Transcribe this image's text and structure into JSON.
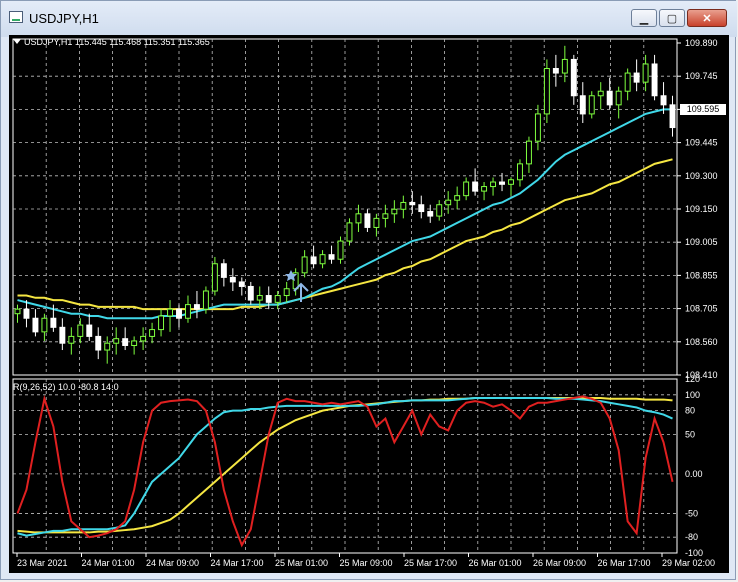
{
  "window": {
    "title": "USDJPY,H1"
  },
  "buttons": {
    "minimize": "▁",
    "maximize": "▢",
    "close": "✕"
  },
  "main_pane": {
    "info": "USDJPY,H1  115.445 115.468 115.351 115.365",
    "price_labels": [
      "109.890",
      "109.745",
      "109.595",
      "109.445",
      "109.300",
      "109.150",
      "109.005",
      "108.855",
      "108.705",
      "108.560",
      "108.410"
    ],
    "current_price": "109.595"
  },
  "indicator_pane": {
    "info": "R(9,26,52) 10.0 -80.8 14.0",
    "level_labels": [
      "120",
      "100",
      "80",
      "50",
      "0.00",
      "-50",
      "-80",
      "-100"
    ]
  },
  "time_labels": [
    "23 Mar 2021",
    "24 Mar 01:00",
    "24 Mar 09:00",
    "24 Mar 17:00",
    "25 Mar 01:00",
    "25 Mar 09:00",
    "25 Mar 17:00",
    "26 Mar 01:00",
    "26 Mar 09:00",
    "26 Mar 17:00",
    "29 Mar 02:00"
  ],
  "colors": {
    "background": "#000000",
    "up_candle": "#7fff3f",
    "down_candle": "#ffffff",
    "ma_fast": "#40d8e8",
    "ma_slow": "#f5e642",
    "osc_red": "#e02020",
    "grid": "#c0c0c0"
  },
  "chart_data": [
    {
      "type": "candlestick",
      "title": "USDJPY,H1",
      "ylim": [
        108.41,
        109.89
      ],
      "candles": [
        [
          108.68,
          108.72,
          108.64,
          108.7
        ],
        [
          108.7,
          108.74,
          108.62,
          108.66
        ],
        [
          108.66,
          108.7,
          108.58,
          108.6
        ],
        [
          108.6,
          108.68,
          108.56,
          108.66
        ],
        [
          108.66,
          108.72,
          108.6,
          108.62
        ],
        [
          108.62,
          108.66,
          108.52,
          108.55
        ],
        [
          108.55,
          108.62,
          108.5,
          108.58
        ],
        [
          108.58,
          108.66,
          108.55,
          108.63
        ],
        [
          108.63,
          108.68,
          108.56,
          108.58
        ],
        [
          108.58,
          108.62,
          108.48,
          108.52
        ],
        [
          108.52,
          108.58,
          108.46,
          108.55
        ],
        [
          108.55,
          108.62,
          108.5,
          108.57
        ],
        [
          108.57,
          108.62,
          108.52,
          108.54
        ],
        [
          108.54,
          108.58,
          108.5,
          108.56
        ],
        [
          108.56,
          108.62,
          108.52,
          108.58
        ],
        [
          108.58,
          108.64,
          108.55,
          108.61
        ],
        [
          108.61,
          108.7,
          108.58,
          108.67
        ],
        [
          108.67,
          108.74,
          108.6,
          108.7
        ],
        [
          108.7,
          108.72,
          108.62,
          108.66
        ],
        [
          108.66,
          108.76,
          108.64,
          108.72
        ],
        [
          108.72,
          108.78,
          108.66,
          108.7
        ],
        [
          108.7,
          108.8,
          108.68,
          108.78
        ],
        [
          108.78,
          108.93,
          108.76,
          108.9
        ],
        [
          108.9,
          108.92,
          108.8,
          108.84
        ],
        [
          108.84,
          108.88,
          108.78,
          108.82
        ],
        [
          108.82,
          108.84,
          108.76,
          108.8
        ],
        [
          108.8,
          108.82,
          108.72,
          108.74
        ],
        [
          108.74,
          108.8,
          108.7,
          108.76
        ],
        [
          108.76,
          108.8,
          108.7,
          108.73
        ],
        [
          108.73,
          108.78,
          108.7,
          108.76
        ],
        [
          108.76,
          108.82,
          108.73,
          108.79
        ],
        [
          108.79,
          108.88,
          108.76,
          108.86
        ],
        [
          108.86,
          108.96,
          108.84,
          108.93
        ],
        [
          108.93,
          108.98,
          108.88,
          108.9
        ],
        [
          108.9,
          108.96,
          108.88,
          108.94
        ],
        [
          108.94,
          108.98,
          108.9,
          108.92
        ],
        [
          108.92,
          109.02,
          108.9,
          109.0
        ],
        [
          109.0,
          109.1,
          108.98,
          109.08
        ],
        [
          109.08,
          109.16,
          109.04,
          109.12
        ],
        [
          109.12,
          109.14,
          109.04,
          109.06
        ],
        [
          109.06,
          109.12,
          109.02,
          109.1
        ],
        [
          109.1,
          109.16,
          109.06,
          109.12
        ],
        [
          109.12,
          109.18,
          109.08,
          109.14
        ],
        [
          109.14,
          109.2,
          109.1,
          109.17
        ],
        [
          109.17,
          109.22,
          109.12,
          109.16
        ],
        [
          109.16,
          109.2,
          109.1,
          109.13
        ],
        [
          109.13,
          109.16,
          109.08,
          109.11
        ],
        [
          109.11,
          109.18,
          109.09,
          109.16
        ],
        [
          109.16,
          109.22,
          109.12,
          109.18
        ],
        [
          109.18,
          109.24,
          109.14,
          109.2
        ],
        [
          109.2,
          109.28,
          109.18,
          109.26
        ],
        [
          109.26,
          109.32,
          109.2,
          109.22
        ],
        [
          109.22,
          109.26,
          109.18,
          109.24
        ],
        [
          109.24,
          109.28,
          109.2,
          109.26
        ],
        [
          109.26,
          109.3,
          109.22,
          109.25
        ],
        [
          109.25,
          109.28,
          109.2,
          109.27
        ],
        [
          109.27,
          109.36,
          109.24,
          109.34
        ],
        [
          109.34,
          109.46,
          109.3,
          109.44
        ],
        [
          109.44,
          109.6,
          109.4,
          109.56
        ],
        [
          109.56,
          109.8,
          109.52,
          109.76
        ],
        [
          109.76,
          109.82,
          109.68,
          109.74
        ],
        [
          109.74,
          109.86,
          109.7,
          109.8
        ],
        [
          109.8,
          109.82,
          109.6,
          109.64
        ],
        [
          109.64,
          109.7,
          109.52,
          109.56
        ],
        [
          109.56,
          109.66,
          109.54,
          109.64
        ],
        [
          109.64,
          109.7,
          109.58,
          109.66
        ],
        [
          109.66,
          109.72,
          109.58,
          109.6
        ],
        [
          109.6,
          109.68,
          109.54,
          109.66
        ],
        [
          109.66,
          109.76,
          109.62,
          109.74
        ],
        [
          109.74,
          109.8,
          109.66,
          109.7
        ],
        [
          109.7,
          109.82,
          109.66,
          109.78
        ],
        [
          109.78,
          109.82,
          109.62,
          109.64
        ],
        [
          109.64,
          109.7,
          109.56,
          109.6
        ],
        [
          109.6,
          109.64,
          109.46,
          109.5
        ]
      ],
      "series": [
        {
          "name": "",
          "values": [
            108.74,
            108.73,
            108.72,
            108.71,
            108.7,
            108.69,
            108.68,
            108.68,
            108.67,
            108.67,
            108.66,
            108.66,
            108.66,
            108.66,
            108.66,
            108.66,
            108.67,
            108.67,
            108.67,
            108.68,
            108.69,
            108.7,
            108.71,
            108.72,
            108.72,
            108.72,
            108.72,
            108.72,
            108.72,
            108.72,
            108.73,
            108.74,
            108.75,
            108.77,
            108.79,
            108.8,
            108.82,
            108.85,
            108.88,
            108.9,
            108.92,
            108.94,
            108.96,
            108.98,
            109.0,
            109.01,
            109.02,
            109.04,
            109.06,
            109.08,
            109.1,
            109.12,
            109.14,
            109.16,
            109.17,
            109.19,
            109.21,
            109.24,
            109.27,
            109.31,
            109.35,
            109.38,
            109.4,
            109.42,
            109.44,
            109.46,
            109.48,
            109.5,
            109.52,
            109.54,
            109.56,
            109.57,
            109.58,
            109.58
          ]
        },
        {
          "name": "",
          "values": [
            108.76,
            108.76,
            108.75,
            108.75,
            108.74,
            108.74,
            108.73,
            108.72,
            108.72,
            108.71,
            108.71,
            108.71,
            108.71,
            108.71,
            108.7,
            108.7,
            108.7,
            108.7,
            108.7,
            108.7,
            108.7,
            108.7,
            108.7,
            108.7,
            108.7,
            108.71,
            108.71,
            108.71,
            108.72,
            108.72,
            108.73,
            108.74,
            108.75,
            108.76,
            108.77,
            108.78,
            108.79,
            108.8,
            108.81,
            108.82,
            108.83,
            108.85,
            108.86,
            108.88,
            108.89,
            108.91,
            108.92,
            108.94,
            108.96,
            108.98,
            109.0,
            109.01,
            109.02,
            109.04,
            109.05,
            109.07,
            109.08,
            109.1,
            109.12,
            109.14,
            109.16,
            109.18,
            109.19,
            109.2,
            109.21,
            109.23,
            109.25,
            109.26,
            109.28,
            109.3,
            109.32,
            109.34,
            109.35,
            109.36
          ]
        }
      ]
    },
    {
      "type": "line",
      "title": "R(9,26,52) 10.0 -80.8 14.0",
      "ylim": [
        -100,
        120
      ],
      "series": [
        {
          "name": "",
          "values": [
            -50,
            -20,
            40,
            95,
            60,
            -10,
            -60,
            -70,
            -80,
            -78,
            -75,
            -70,
            -60,
            -20,
            40,
            80,
            90,
            92,
            93,
            94,
            92,
            80,
            40,
            -20,
            -60,
            -90,
            -70,
            -10,
            50,
            90,
            95,
            92,
            92,
            90,
            88,
            90,
            88,
            90,
            92,
            85,
            60,
            70,
            40,
            60,
            80,
            50,
            75,
            60,
            55,
            80,
            90,
            92,
            90,
            85,
            88,
            80,
            70,
            85,
            90,
            90,
            92,
            94,
            96,
            98,
            95,
            90,
            70,
            30,
            -60,
            -75,
            20,
            70,
            40,
            -10
          ]
        },
        {
          "name": "",
          "values": [
            -75,
            -78,
            -76,
            -74,
            -72,
            -72,
            -70,
            -70,
            -70,
            -70,
            -70,
            -68,
            -65,
            -50,
            -30,
            -10,
            0,
            10,
            20,
            35,
            50,
            60,
            70,
            78,
            80,
            80,
            82,
            82,
            84,
            85,
            86,
            86,
            86,
            86,
            86,
            86,
            86,
            86,
            86,
            87,
            88,
            90,
            92,
            92,
            93,
            93,
            93,
            93,
            93,
            94,
            95,
            96,
            96,
            96,
            96,
            96,
            96,
            96,
            96,
            96,
            95,
            95,
            95,
            94,
            93,
            92,
            90,
            88,
            86,
            84,
            80,
            78,
            75,
            70
          ]
        },
        {
          "name": "",
          "values": [
            -72,
            -73,
            -74,
            -74,
            -74,
            -74,
            -74,
            -74,
            -74,
            -73,
            -73,
            -72,
            -71,
            -70,
            -68,
            -66,
            -62,
            -58,
            -50,
            -40,
            -30,
            -20,
            -10,
            0,
            10,
            20,
            30,
            40,
            48,
            56,
            62,
            68,
            72,
            76,
            80,
            82,
            84,
            86,
            87,
            88,
            89,
            90,
            91,
            92,
            93,
            93,
            94,
            94,
            95,
            95,
            95,
            96,
            96,
            96,
            96,
            96,
            96,
            96,
            96,
            96,
            96,
            96,
            96,
            96,
            96,
            96,
            95,
            95,
            95,
            95,
            94,
            94,
            94,
            93
          ]
        }
      ]
    }
  ]
}
